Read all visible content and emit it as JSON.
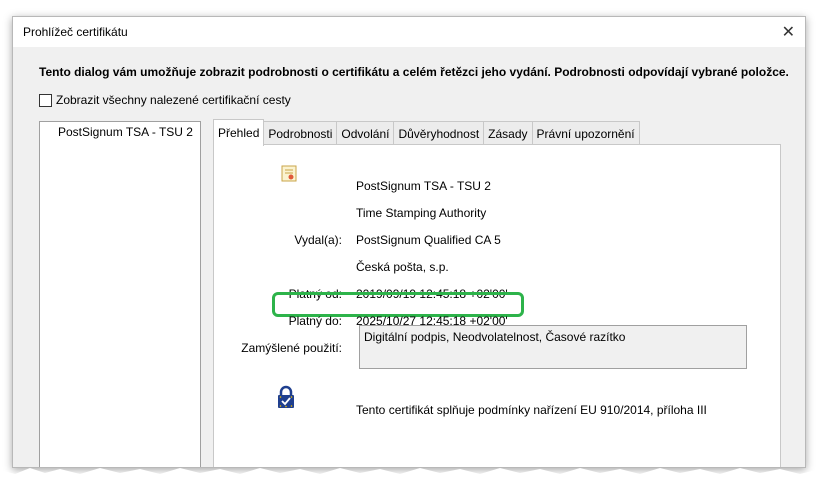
{
  "window": {
    "title": "Prohlížeč certifikátu",
    "close_glyph": "✕"
  },
  "description": "Tento dialog vám umožňuje zobrazit podrobnosti o certifikátu a celém řetězci jeho vydání. Podrobnosti odpovídají vybrané položce.",
  "show_all_paths": {
    "label": "Zobrazit všechny nalezené certifikační cesty",
    "checked": false
  },
  "tree": {
    "items": [
      {
        "label": "PostSignum TSA - TSU 2"
      }
    ]
  },
  "tabs": [
    {
      "label": "Přehled",
      "active": true
    },
    {
      "label": "Podrobnosti"
    },
    {
      "label": "Odvolání"
    },
    {
      "label": "Důvěryhodnost"
    },
    {
      "label": "Zásady"
    },
    {
      "label": "Právní upozornění"
    }
  ],
  "overview": {
    "subject_name": "PostSignum TSA - TSU 2",
    "subject_org": "Time Stamping Authority",
    "issued_by_label": "Vydal(a):",
    "issuer_name": "PostSignum Qualified CA 5",
    "issuer_org": "Česká pošta, s.p.",
    "valid_from_label": "Platný od:",
    "valid_from": "2019/09/19 12:45:18 +02'00'",
    "valid_to_label": "Platný do:",
    "valid_to": "2025/10/27 12:45:18 +02'00'",
    "intended_use_label": "Zamýšlené použití:",
    "intended_use": "Digitální podpis, Neodvolatelnost, Časové razítko",
    "eu_note": "Tento certifikát splňuje podmínky nařízení EU 910/2014, příloha III"
  },
  "icons": {
    "cert": "certificate-icon",
    "eu_lock": "eu-trust-lock-icon"
  },
  "colors": {
    "highlight": "#2db34a",
    "eu_blue": "#1f3f8f",
    "eu_star": "#f2c200"
  }
}
